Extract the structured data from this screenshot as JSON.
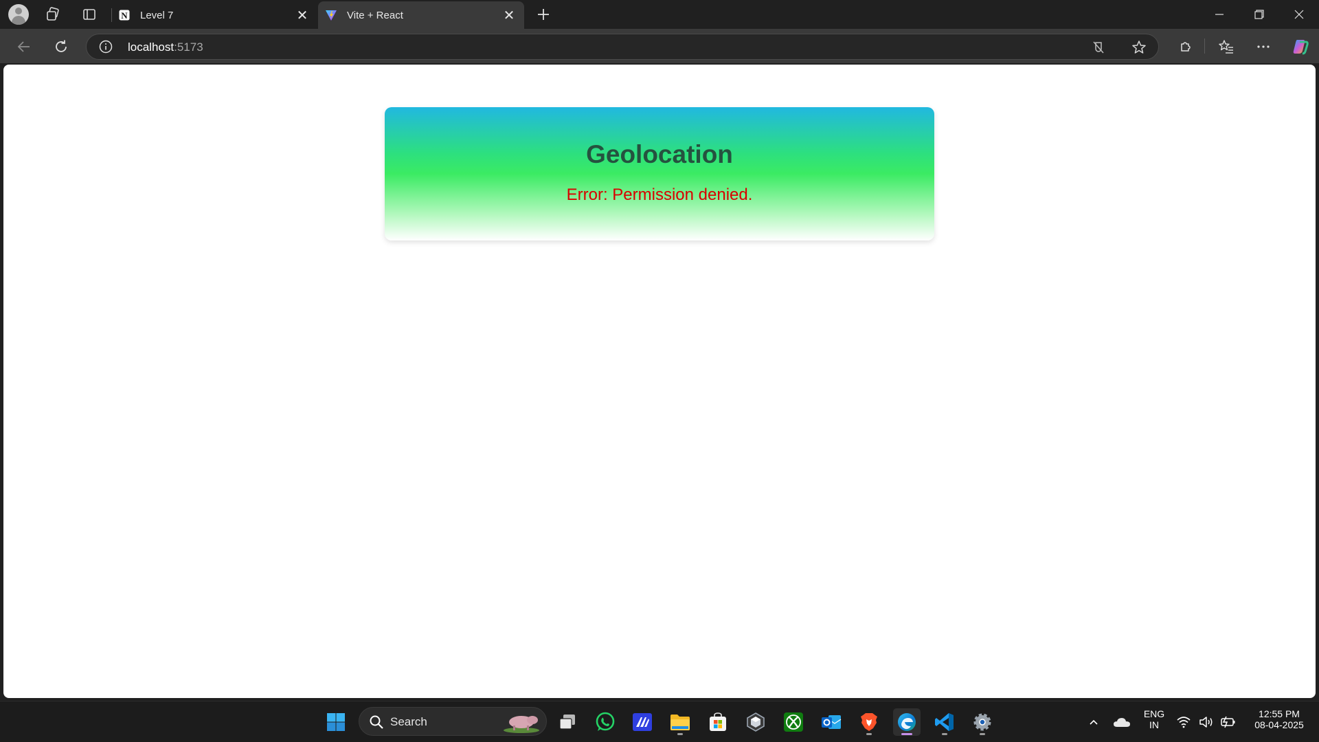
{
  "browser": {
    "tabs": [
      {
        "title": "Level 7",
        "favicon": "notion-icon",
        "active": false
      },
      {
        "title": "Vite + React",
        "favicon": "vite-icon",
        "active": true
      }
    ],
    "address": {
      "host": "localhost",
      "port": ":5173"
    }
  },
  "page": {
    "heading": "Geolocation",
    "error": "Error: Permission denied."
  },
  "taskbar": {
    "search_label": "Search",
    "language": {
      "line1": "ENG",
      "line2": "IN"
    },
    "clock": {
      "time": "12:55 PM",
      "date": "08-04-2025"
    },
    "apps": [
      "windows-start-icon",
      "search",
      "task-view-icon",
      "whatsapp-icon",
      "app-icon",
      "file-explorer-icon",
      "microsoft-store-icon",
      "unity-icon",
      "xbox-icon",
      "outlook-icon",
      "brave-icon",
      "edge-icon",
      "vscode-icon",
      "settings-icon"
    ]
  },
  "colors": {
    "error_red": "#d90000",
    "heading_green": "#25523f",
    "gradient_top": "#21b8e0",
    "gradient_mid": "#3beb63"
  }
}
